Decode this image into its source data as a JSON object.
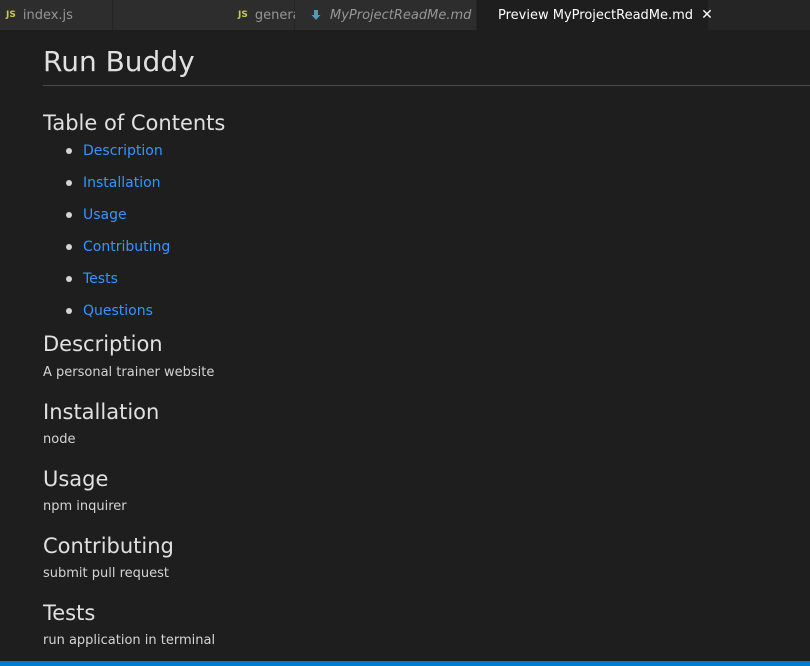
{
  "tabs": [
    {
      "badge": "JS",
      "label": "index.js",
      "italic": false,
      "active": false
    },
    {
      "badge": "JS",
      "label": "generateMarkdown.js",
      "italic": false,
      "active": false
    },
    {
      "icon": "markdown-download-icon",
      "label": "MyProjectReadMe.md",
      "italic": true,
      "active": false
    },
    {
      "icon": "preview-icon",
      "label": "Preview MyProjectReadMe.md",
      "italic": false,
      "active": true,
      "close": "✕"
    }
  ],
  "doc": {
    "title": "Run Buddy",
    "toc_heading": "Table of Contents",
    "toc": [
      "Description",
      "Installation",
      "Usage",
      "Contributing",
      "Tests",
      "Questions"
    ],
    "sections": [
      {
        "heading": "Description",
        "body": "A personal trainer website"
      },
      {
        "heading": "Installation",
        "body": "node"
      },
      {
        "heading": "Usage",
        "body": "npm inquirer"
      },
      {
        "heading": "Contributing",
        "body": "submit pull request"
      },
      {
        "heading": "Tests",
        "body": "run application in terminal"
      }
    ]
  },
  "colors": {
    "background": "#1e1e1e",
    "link": "#3794ff",
    "js_badge": "#cbcb41",
    "status_bar": "#007acc"
  }
}
